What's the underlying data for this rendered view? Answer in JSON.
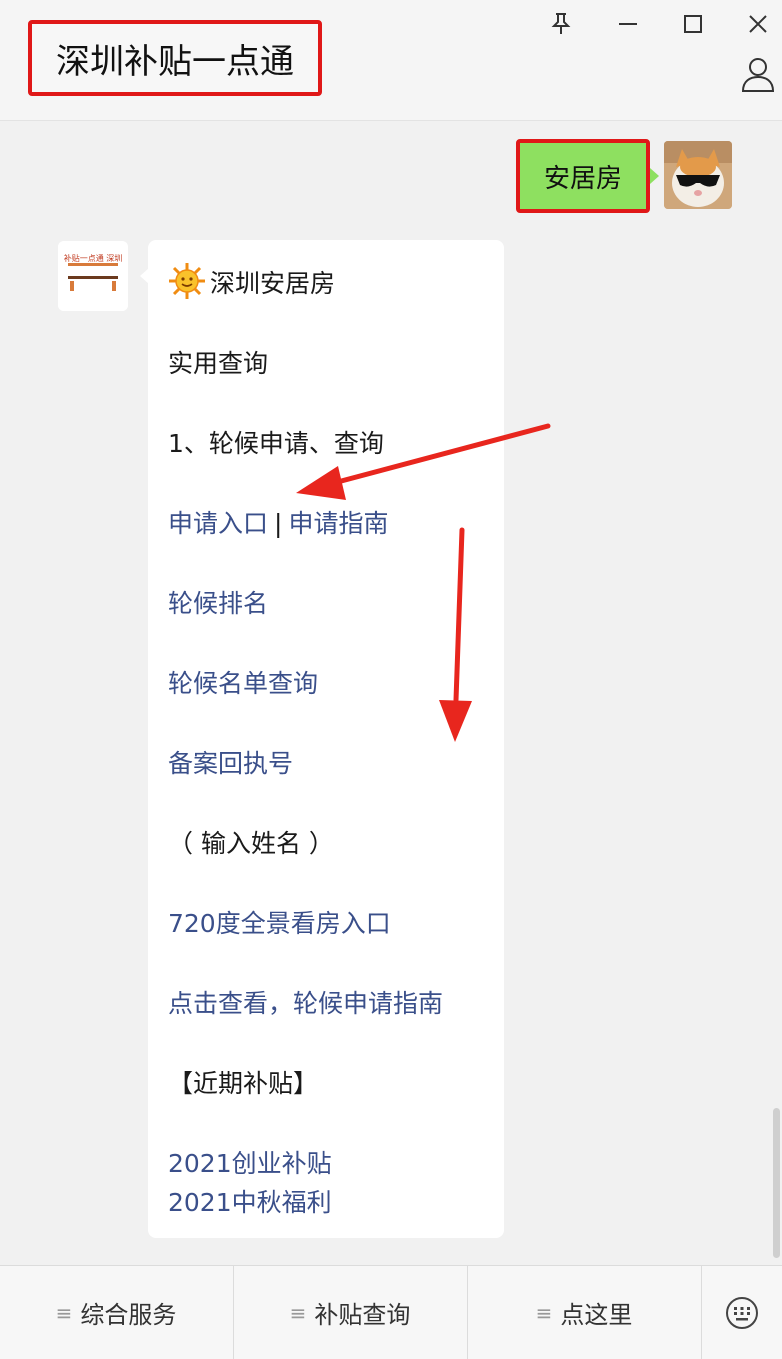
{
  "window": {
    "title": "深圳补贴一点通"
  },
  "chat": {
    "user_message": "安居房",
    "reply": {
      "heading_emoji": "sun-face-emoji",
      "heading": "深圳安居房",
      "section_title": "实用查询",
      "item_title": "1、轮候申请、查询",
      "apply_entry": "申请入口",
      "separator": "|",
      "apply_guide": "申请指南",
      "queue_rank": "轮候排名",
      "queue_list": "轮候名单查询",
      "record_receipt": "备案回执号",
      "input_name": "（ 输入姓名 ）",
      "panorama": "720度全景看房入口",
      "click_guide": "点击查看，轮候申请指南",
      "recent_title": "【近期补贴】",
      "subsidy_2021_startup": "2021创业补贴",
      "subsidy_2021_midautumn": "2021中秋福利"
    },
    "bot_avatar_text": "补贴一点通 深圳"
  },
  "bottom_menu": {
    "items": [
      "综合服务",
      "补贴查询",
      "点这里"
    ]
  },
  "colors": {
    "highlight_border": "#e01818",
    "user_bubble": "#8ee060",
    "link": "#3a4f8a",
    "arrow": "#e8261e"
  }
}
